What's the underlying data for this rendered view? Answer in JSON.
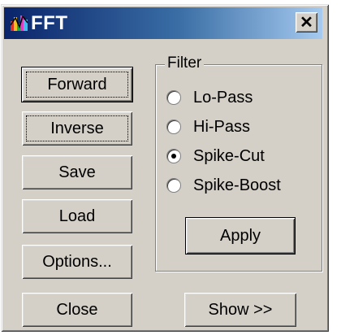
{
  "window": {
    "title": "FFT",
    "close_symbol": "✕",
    "app_icon": "fft-app-icon"
  },
  "left_buttons": {
    "forward": "Forward",
    "inverse": "Inverse",
    "save": "Save",
    "load": "Load",
    "options": "Options...",
    "close": "Close"
  },
  "filter": {
    "label": "Filter",
    "options": [
      {
        "label": "Lo-Pass",
        "checked": false
      },
      {
        "label": "Hi-Pass",
        "checked": false
      },
      {
        "label": "Spike-Cut",
        "checked": true
      },
      {
        "label": "Spike-Boost",
        "checked": false
      }
    ],
    "apply_label": "Apply"
  },
  "show_button": "Show >>",
  "colors": {
    "title_gradient_start": "#0a246a",
    "title_gradient_end": "#a6caf0",
    "face": "#d4d0c8"
  }
}
